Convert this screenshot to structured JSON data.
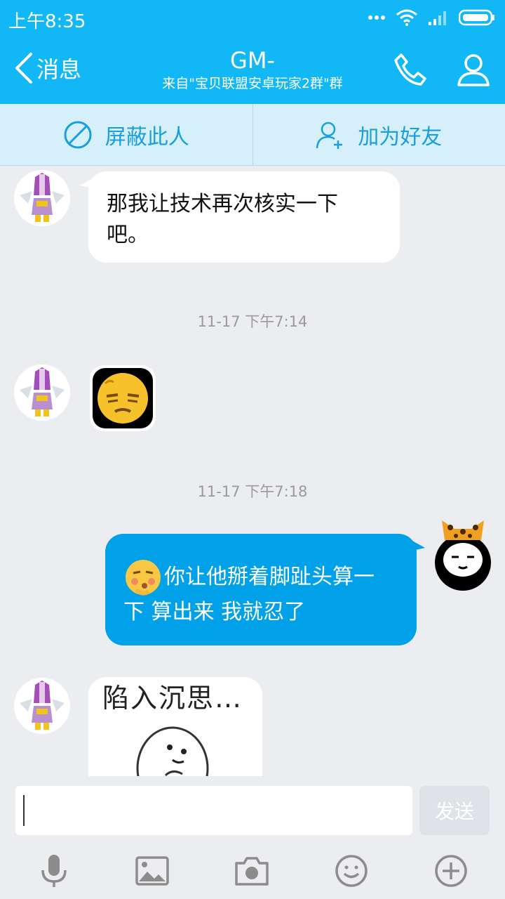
{
  "status": {
    "time": "上午8:35"
  },
  "header": {
    "back_label": "消息",
    "title": "GM-",
    "subtitle": "来自\"宝贝联盟安卓玩家2群\"群"
  },
  "actions": {
    "block_label": "屏蔽此人",
    "add_friend_label": "加为好友"
  },
  "messages": [
    {
      "direction": "in",
      "type": "text",
      "text_line1": "那我让技术再次核实一下",
      "text_line2": "吧。"
    },
    {
      "type": "timestamp",
      "text": "11-17 下午7:14"
    },
    {
      "direction": "in",
      "type": "emoji",
      "emoji": "face-emoji"
    },
    {
      "type": "timestamp",
      "text": "11-17 下午7:18"
    },
    {
      "direction": "out",
      "type": "text",
      "text_line1": "你让他掰着脚趾头算一",
      "text_line2": "下 算出来 我就忍了"
    },
    {
      "direction": "in",
      "type": "sticker",
      "caption": "陷入沉思…"
    }
  ],
  "composer": {
    "send_label": "发送"
  },
  "colors": {
    "brand": "#12b7f5",
    "out_bubble": "#00a1e8",
    "action_bg": "#d5f0fb"
  }
}
